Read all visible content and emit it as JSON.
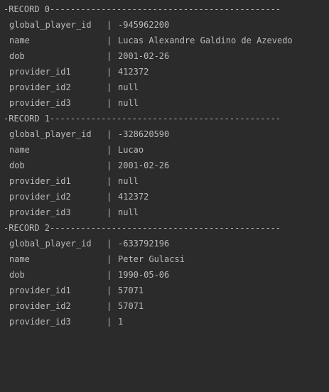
{
  "separator": "|",
  "records": [
    {
      "header": "-RECORD 0---------------------------------------------",
      "fields": [
        {
          "key": "global_player_id",
          "value": "-945962200"
        },
        {
          "key": "name",
          "value": "Lucas Alexandre Galdino de Azevedo"
        },
        {
          "key": "dob",
          "value": "2001-02-26"
        },
        {
          "key": "provider_id1",
          "value": "412372"
        },
        {
          "key": "provider_id2",
          "value": "null"
        },
        {
          "key": "provider_id3",
          "value": "null"
        }
      ]
    },
    {
      "header": "-RECORD 1---------------------------------------------",
      "fields": [
        {
          "key": "global_player_id",
          "value": "-328620590"
        },
        {
          "key": "name",
          "value": "Lucao"
        },
        {
          "key": "dob",
          "value": "2001-02-26"
        },
        {
          "key": "provider_id1",
          "value": "null"
        },
        {
          "key": "provider_id2",
          "value": "412372"
        },
        {
          "key": "provider_id3",
          "value": "null"
        }
      ]
    },
    {
      "header": "-RECORD 2---------------------------------------------",
      "fields": [
        {
          "key": "global_player_id",
          "value": "-633792196"
        },
        {
          "key": "name",
          "value": "Peter Gulacsi"
        },
        {
          "key": "dob",
          "value": "1990-05-06"
        },
        {
          "key": "provider_id1",
          "value": "57071"
        },
        {
          "key": "provider_id2",
          "value": "57071"
        },
        {
          "key": "provider_id3",
          "value": "1"
        }
      ]
    }
  ]
}
